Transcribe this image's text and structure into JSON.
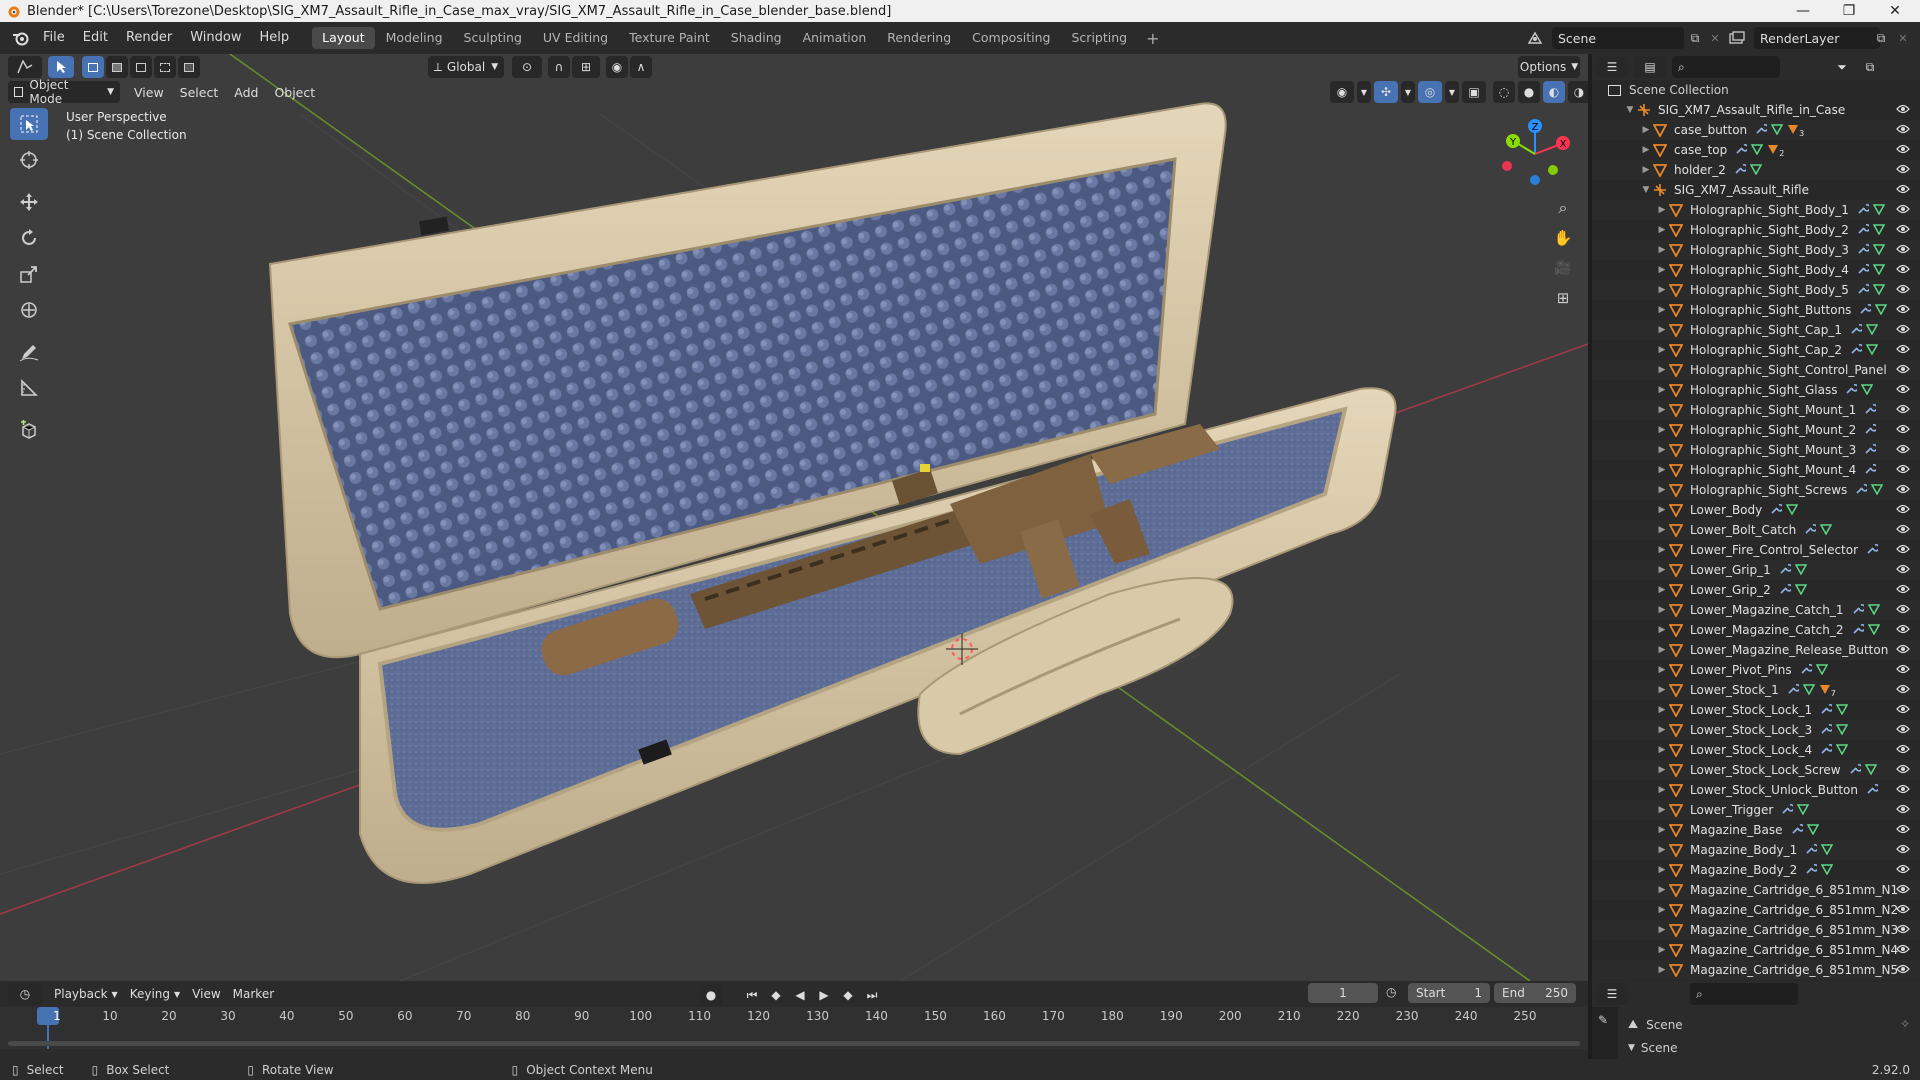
{
  "window": {
    "title": "Blender* [C:\\Users\\Torezone\\Desktop\\SIG_XM7_Assault_Rifle_in_Case_max_vray/SIG_XM7_Assault_Rifle_in_Case_blender_base.blend]",
    "controls": [
      "minimize",
      "maximize",
      "close"
    ]
  },
  "menubar": {
    "menus": [
      "File",
      "Edit",
      "Render",
      "Window",
      "Help"
    ],
    "workspaces": [
      "Layout",
      "Modeling",
      "Sculpting",
      "UV Editing",
      "Texture Paint",
      "Shading",
      "Animation",
      "Rendering",
      "Compositing",
      "Scripting"
    ],
    "active_workspace": "Layout",
    "scene": "Scene",
    "view_layer": "RenderLayer"
  },
  "viewport": {
    "mode": "Object Mode",
    "menus": [
      "View",
      "Select",
      "Add",
      "Object"
    ],
    "transform_orientation": "Global",
    "options_label": "Options",
    "overlay_line1": "User Perspective",
    "overlay_line2": "(1) Scene Collection",
    "tools": [
      "select-box",
      "cursor",
      "move",
      "rotate",
      "scale",
      "transform",
      "annotate",
      "measure",
      "add-cube"
    ],
    "gizmo_axes": [
      "X",
      "Y",
      "Z"
    ]
  },
  "outliner": {
    "root": "Scene Collection",
    "rows": [
      {
        "name": "SIG_XM7_Assault_Rifle_in_Case",
        "depth": 1,
        "type": "empty",
        "expanded": true
      },
      {
        "name": "case_button",
        "depth": 2,
        "type": "mesh",
        "mods": [
          "wrench",
          "mesh",
          "material"
        ],
        "badge": "3"
      },
      {
        "name": "case_top",
        "depth": 2,
        "type": "mesh",
        "mods": [
          "wrench",
          "mesh",
          "material"
        ],
        "badge": "2"
      },
      {
        "name": "holder_2",
        "depth": 2,
        "type": "mesh",
        "mods": [
          "wrench",
          "mesh"
        ]
      },
      {
        "name": "SIG_XM7_Assault_Rifle",
        "depth": 2,
        "type": "empty",
        "expanded": true
      },
      {
        "name": "Holographic_Sight_Body_1",
        "depth": 3,
        "type": "mesh",
        "mods": [
          "wrench",
          "mesh"
        ]
      },
      {
        "name": "Holographic_Sight_Body_2",
        "depth": 3,
        "type": "mesh",
        "mods": [
          "wrench",
          "mesh"
        ]
      },
      {
        "name": "Holographic_Sight_Body_3",
        "depth": 3,
        "type": "mesh",
        "mods": [
          "wrench",
          "mesh"
        ]
      },
      {
        "name": "Holographic_Sight_Body_4",
        "depth": 3,
        "type": "mesh",
        "mods": [
          "wrench",
          "mesh"
        ]
      },
      {
        "name": "Holographic_Sight_Body_5",
        "depth": 3,
        "type": "mesh",
        "mods": [
          "wrench",
          "mesh"
        ]
      },
      {
        "name": "Holographic_Sight_Buttons",
        "depth": 3,
        "type": "mesh",
        "mods": [
          "wrench",
          "mesh"
        ]
      },
      {
        "name": "Holographic_Sight_Cap_1",
        "depth": 3,
        "type": "mesh",
        "mods": [
          "wrench",
          "mesh"
        ]
      },
      {
        "name": "Holographic_Sight_Cap_2",
        "depth": 3,
        "type": "mesh",
        "mods": [
          "wrench",
          "mesh"
        ]
      },
      {
        "name": "Holographic_Sight_Control_Panel",
        "depth": 3,
        "type": "mesh",
        "mods": []
      },
      {
        "name": "Holographic_Sight_Glass",
        "depth": 3,
        "type": "mesh",
        "mods": [
          "wrench",
          "mesh"
        ]
      },
      {
        "name": "Holographic_Sight_Mount_1",
        "depth": 3,
        "type": "mesh",
        "mods": [
          "wrench"
        ]
      },
      {
        "name": "Holographic_Sight_Mount_2",
        "depth": 3,
        "type": "mesh",
        "mods": [
          "wrench"
        ]
      },
      {
        "name": "Holographic_Sight_Mount_3",
        "depth": 3,
        "type": "mesh",
        "mods": [
          "wrench"
        ]
      },
      {
        "name": "Holographic_Sight_Mount_4",
        "depth": 3,
        "type": "mesh",
        "mods": [
          "wrench"
        ]
      },
      {
        "name": "Holographic_Sight_Screws",
        "depth": 3,
        "type": "mesh",
        "mods": [
          "wrench",
          "mesh"
        ]
      },
      {
        "name": "Lower_Body",
        "depth": 3,
        "type": "mesh",
        "mods": [
          "wrench",
          "mesh"
        ]
      },
      {
        "name": "Lower_Bolt_Catch",
        "depth": 3,
        "type": "mesh",
        "mods": [
          "wrench",
          "mesh"
        ]
      },
      {
        "name": "Lower_Fire_Control_Selector",
        "depth": 3,
        "type": "mesh",
        "mods": [
          "wrench"
        ]
      },
      {
        "name": "Lower_Grip_1",
        "depth": 3,
        "type": "mesh",
        "mods": [
          "wrench",
          "mesh"
        ]
      },
      {
        "name": "Lower_Grip_2",
        "depth": 3,
        "type": "mesh",
        "mods": [
          "wrench",
          "mesh"
        ]
      },
      {
        "name": "Lower_Magazine_Catch_1",
        "depth": 3,
        "type": "mesh",
        "mods": [
          "wrench",
          "mesh"
        ]
      },
      {
        "name": "Lower_Magazine_Catch_2",
        "depth": 3,
        "type": "mesh",
        "mods": [
          "wrench",
          "mesh"
        ]
      },
      {
        "name": "Lower_Magazine_Release_Button",
        "depth": 3,
        "type": "mesh",
        "mods": []
      },
      {
        "name": "Lower_Pivot_Pins",
        "depth": 3,
        "type": "mesh",
        "mods": [
          "wrench",
          "mesh"
        ]
      },
      {
        "name": "Lower_Stock_1",
        "depth": 3,
        "type": "mesh",
        "mods": [
          "wrench",
          "mesh",
          "material"
        ],
        "badge": "7"
      },
      {
        "name": "Lower_Stock_Lock_1",
        "depth": 3,
        "type": "mesh",
        "mods": [
          "wrench",
          "mesh"
        ]
      },
      {
        "name": "Lower_Stock_Lock_3",
        "depth": 3,
        "type": "mesh",
        "mods": [
          "wrench",
          "mesh"
        ]
      },
      {
        "name": "Lower_Stock_Lock_4",
        "depth": 3,
        "type": "mesh",
        "mods": [
          "wrench",
          "mesh"
        ]
      },
      {
        "name": "Lower_Stock_Lock_Screw",
        "depth": 3,
        "type": "mesh",
        "mods": [
          "wrench",
          "mesh"
        ]
      },
      {
        "name": "Lower_Stock_Unlock_Button",
        "depth": 3,
        "type": "mesh",
        "mods": [
          "wrench"
        ]
      },
      {
        "name": "Lower_Trigger",
        "depth": 3,
        "type": "mesh",
        "mods": [
          "wrench",
          "mesh"
        ]
      },
      {
        "name": "Magazine_Base",
        "depth": 3,
        "type": "mesh",
        "mods": [
          "wrench",
          "mesh"
        ]
      },
      {
        "name": "Magazine_Body_1",
        "depth": 3,
        "type": "mesh",
        "mods": [
          "wrench",
          "mesh"
        ]
      },
      {
        "name": "Magazine_Body_2",
        "depth": 3,
        "type": "mesh",
        "mods": [
          "wrench",
          "mesh"
        ]
      },
      {
        "name": "Magazine_Cartridge_6_851mm_N1",
        "depth": 3,
        "type": "mesh",
        "mods": []
      },
      {
        "name": "Magazine_Cartridge_6_851mm_N2",
        "depth": 3,
        "type": "mesh",
        "mods": []
      },
      {
        "name": "Magazine_Cartridge_6_851mm_N3",
        "depth": 3,
        "type": "mesh",
        "mods": []
      },
      {
        "name": "Magazine_Cartridge_6_851mm_N4",
        "depth": 3,
        "type": "mesh",
        "mods": []
      },
      {
        "name": "Magazine_Cartridge_6_851mm_N5",
        "depth": 3,
        "type": "mesh",
        "mods": []
      }
    ]
  },
  "timeline": {
    "menus": [
      "Playback",
      "Keying",
      "View",
      "Marker"
    ],
    "current_frame": "1",
    "start_label": "Start",
    "start": "1",
    "end_label": "End",
    "end": "250",
    "ticks": [
      "1",
      "10",
      "20",
      "30",
      "40",
      "50",
      "60",
      "70",
      "80",
      "90",
      "100",
      "110",
      "120",
      "130",
      "140",
      "150",
      "160",
      "170",
      "180",
      "190",
      "200",
      "210",
      "220",
      "230",
      "240",
      "250"
    ]
  },
  "properties": {
    "scene_label": "Scene",
    "section": "Scene"
  },
  "statusbar": {
    "items": [
      "Select",
      "Box Select",
      "Rotate View",
      "Object Context Menu"
    ],
    "version": "2.92.0"
  },
  "colors": {
    "accent": "#4772b3",
    "object_orange": "#e8872b",
    "mesh_green": "#5cd685",
    "axis_x": "#ff3352",
    "axis_y": "#8bdc00",
    "axis_z": "#2890ff"
  }
}
